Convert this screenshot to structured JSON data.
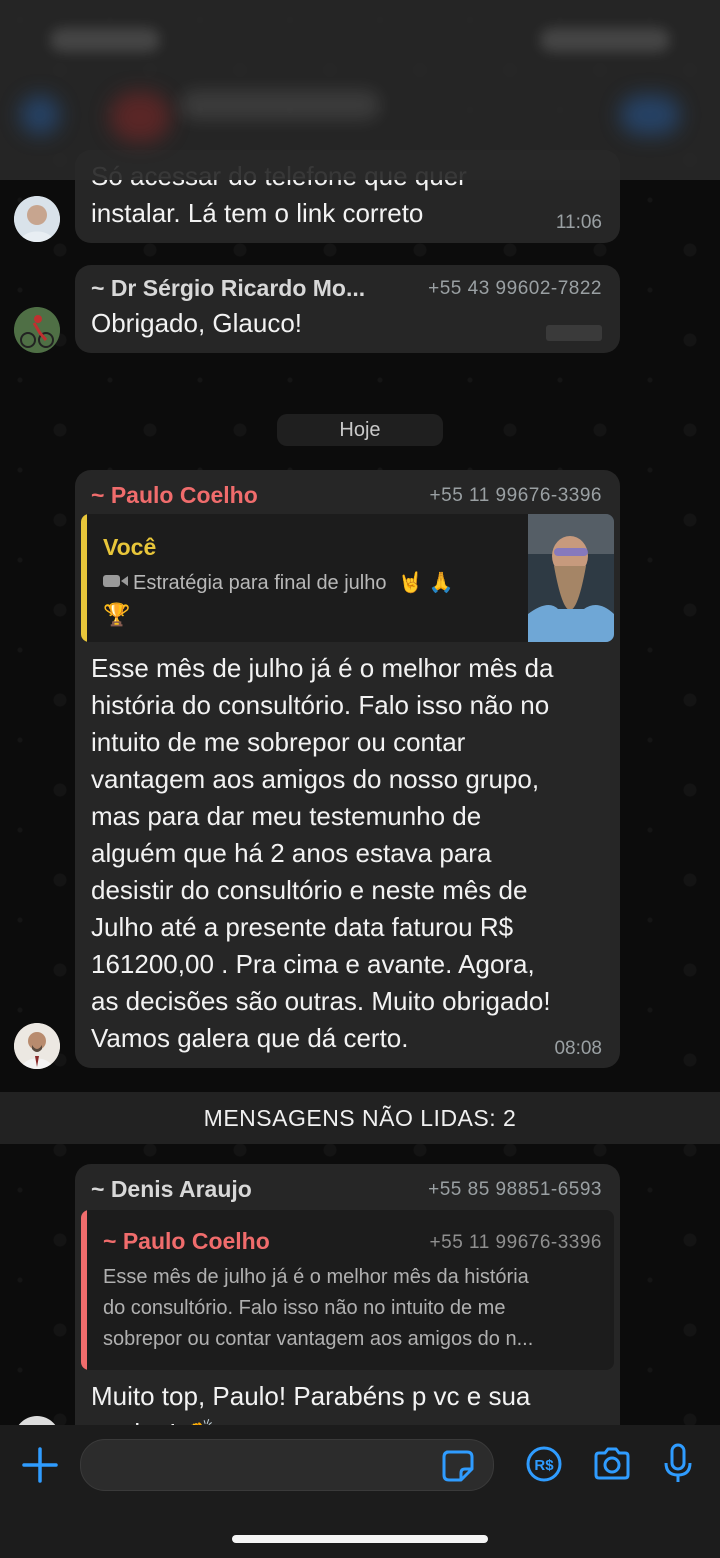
{
  "messages": [
    {
      "partial_line": "Só acessar do telefone que quer",
      "text": "instalar.  Lá tem o link correto",
      "time": "11:06"
    },
    {
      "sender": "~ Dr Sérgio Ricardo Mo...",
      "phone": "+55 43 99602-7822",
      "text": "Obrigado, Glauco!"
    },
    {
      "sender": "~ Paulo Coelho",
      "phone": "+55 11 99676-3396",
      "quote": {
        "author": "Você",
        "text": "Estratégia para final de julho",
        "emoji_line1": "🤘 🙏",
        "emoji_line2": "🏆"
      },
      "lines": [
        "Esse mês de julho já é o melhor mês da",
        "história do consultório. Falo isso não no",
        "intuito de me sobrepor ou contar",
        "vantagem aos amigos do nosso grupo,",
        "mas para dar meu testemunho de",
        "alguém que há 2 anos estava para",
        "desistir do consultório e neste mês de",
        "Julho até a presente data faturou R$",
        "161200,00 . Pra cima e avante. Agora,",
        "as decisões são outras. Muito obrigado!",
        "Vamos  galera que dá certo."
      ],
      "time": "08:08"
    },
    {
      "sender": "~ Denis Araujo",
      "phone": "+55 85 98851-6593",
      "quote": {
        "author": "~ Paulo Coelho",
        "phone": "+55 11 99676-3396",
        "lines": [
          "Esse mês de julho já é o melhor mês da história",
          "do consultório. Falo isso não no intuito de me",
          "sobrepor ou contar vantagem aos amigos do n..."
        ]
      },
      "text": "Muito top, Paulo! Parabéns p vc e sua",
      "partial_line": "equipe! 👏"
    }
  ],
  "day_separator": "Hoje",
  "unread_banner": "MENSAGENS NÃO LIDAS: 2",
  "composer": {
    "icons": [
      "plus-icon",
      "sticker-icon",
      "pix-rs-icon",
      "camera-icon",
      "microphone-icon"
    ],
    "pix_label": "R$"
  },
  "colors": {
    "accent_blue": "#2f9cff",
    "sender_red": "#f06c6c",
    "sender_light": "#d8d8d8",
    "quote_you": "#e8c63a"
  }
}
